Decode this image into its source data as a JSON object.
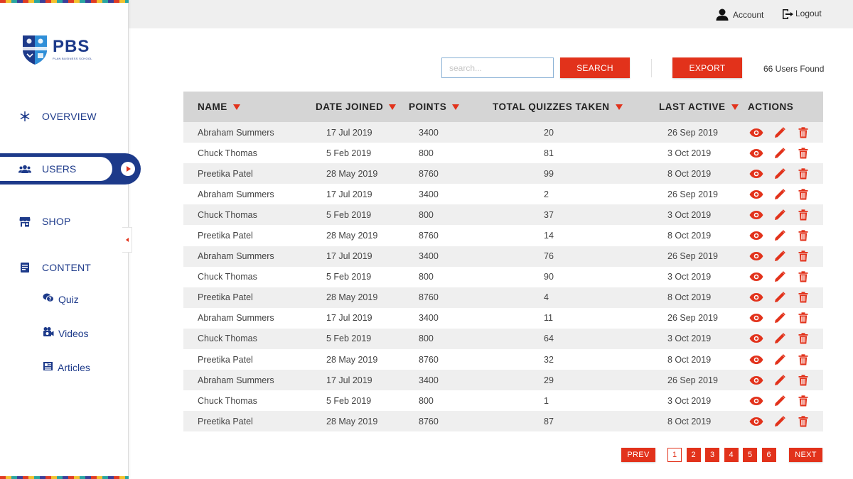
{
  "brand": {
    "name": "PBS",
    "tagline": "PLAN BUSINESS SCHOOL"
  },
  "colors": {
    "accent": "#e2321b",
    "brand": "#1d3a8a",
    "header_bg": "#d5d5d5"
  },
  "sidebar": {
    "items": [
      {
        "label": "OVERVIEW",
        "icon": "snowflake-icon"
      },
      {
        "label": "USERS",
        "icon": "users-icon",
        "active": true
      },
      {
        "label": "SHOP",
        "icon": "store-icon"
      },
      {
        "label": "CONTENT",
        "icon": "document-icon"
      }
    ],
    "subitems": [
      {
        "label": "Quiz",
        "icon": "quiz-bubble-icon"
      },
      {
        "label": "Videos",
        "icon": "video-camera-icon"
      },
      {
        "label": "Articles",
        "icon": "article-icon"
      }
    ]
  },
  "topbar": {
    "account": "Account",
    "logout": "Logout"
  },
  "toolbar": {
    "search_placeholder": "search...",
    "search_button": "SEARCH",
    "export_button": "EXPORT",
    "users_found": "66 Users Found"
  },
  "table": {
    "columns": [
      "NAME",
      "DATE JOINED",
      "POINTS",
      "TOTAL QUIZZES TAKEN",
      "LAST ACTIVE",
      "ACTIONS"
    ],
    "rows": [
      {
        "name": "Abraham Summers",
        "joined": "17 Jul 2019",
        "points": "3400",
        "quizzes": "20",
        "last_active": "26 Sep 2019"
      },
      {
        "name": "Chuck Thomas",
        "joined": "5 Feb 2019",
        "points": "800",
        "quizzes": "81",
        "last_active": "3 Oct 2019"
      },
      {
        "name": "Preetika Patel",
        "joined": "28 May 2019",
        "points": "8760",
        "quizzes": "99",
        "last_active": "8 Oct 2019"
      },
      {
        "name": "Abraham Summers",
        "joined": "17 Jul 2019",
        "points": "3400",
        "quizzes": "2",
        "last_active": "26 Sep 2019"
      },
      {
        "name": "Chuck Thomas",
        "joined": "5 Feb 2019",
        "points": "800",
        "quizzes": "37",
        "last_active": "3 Oct 2019"
      },
      {
        "name": "Preetika Patel",
        "joined": "28 May 2019",
        "points": "8760",
        "quizzes": "14",
        "last_active": "8 Oct 2019"
      },
      {
        "name": "Abraham Summers",
        "joined": "17 Jul 2019",
        "points": "3400",
        "quizzes": "76",
        "last_active": "26 Sep 2019"
      },
      {
        "name": "Chuck Thomas",
        "joined": "5 Feb 2019",
        "points": "800",
        "quizzes": "90",
        "last_active": "3 Oct 2019"
      },
      {
        "name": "Preetika Patel",
        "joined": "28 May 2019",
        "points": "8760",
        "quizzes": "4",
        "last_active": "8 Oct 2019"
      },
      {
        "name": "Abraham Summers",
        "joined": "17 Jul 2019",
        "points": "3400",
        "quizzes": "11",
        "last_active": "26 Sep 2019"
      },
      {
        "name": "Chuck Thomas",
        "joined": "5 Feb 2019",
        "points": "800",
        "quizzes": "64",
        "last_active": "3 Oct 2019"
      },
      {
        "name": "Preetika Patel",
        "joined": "28 May 2019",
        "points": "8760",
        "quizzes": "32",
        "last_active": "8 Oct 2019"
      },
      {
        "name": "Abraham Summers",
        "joined": "17 Jul 2019",
        "points": "3400",
        "quizzes": "29",
        "last_active": "26 Sep 2019"
      },
      {
        "name": "Chuck Thomas",
        "joined": "5 Feb 2019",
        "points": "800",
        "quizzes": "1",
        "last_active": "3 Oct 2019"
      },
      {
        "name": "Preetika Patel",
        "joined": "28 May 2019",
        "points": "8760",
        "quizzes": "87",
        "last_active": "8 Oct 2019"
      }
    ],
    "row_actions": [
      "eye-icon",
      "pencil-icon",
      "trash-icon"
    ]
  },
  "pagination": {
    "prev": "PREV",
    "next": "NEXT",
    "pages": [
      "1",
      "2",
      "3",
      "4",
      "5",
      "6"
    ],
    "current": "1"
  }
}
